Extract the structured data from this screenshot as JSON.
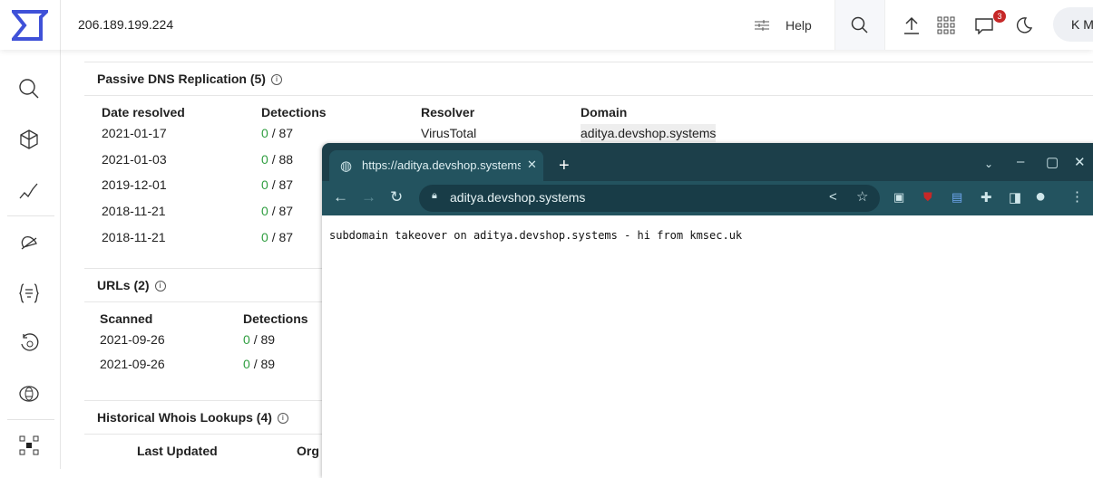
{
  "header": {
    "ip": "206.189.199.224",
    "help": "Help",
    "notification_count": "3",
    "user_initials": "K M"
  },
  "sidebar": {
    "items": [
      "search",
      "graph",
      "trend",
      "alerts",
      "rules",
      "retrohunt",
      "intelligence",
      "scan"
    ]
  },
  "passive_dns": {
    "title": "Passive DNS Replication",
    "count": "(5)",
    "columns": [
      "Date resolved",
      "Detections",
      "Resolver",
      "Domain"
    ],
    "rows": [
      [
        "2021-01-17",
        "0",
        "/ 87",
        "VirusTotal",
        "aditya.devshop.systems"
      ],
      [
        "2021-01-03",
        "0",
        "/ 88",
        "",
        ""
      ],
      [
        "2019-12-01",
        "0",
        "/ 87",
        "",
        ""
      ],
      [
        "2018-11-21",
        "0",
        "/ 87",
        "",
        ""
      ],
      [
        "2018-11-21",
        "0",
        "/ 87",
        "",
        ""
      ]
    ]
  },
  "urls": {
    "title": "URLs",
    "count": "(2)",
    "columns": [
      "Scanned",
      "Detections"
    ],
    "rows": [
      [
        "2021-09-26",
        "0",
        "/ 89"
      ],
      [
        "2021-09-26",
        "0",
        "/ 89"
      ]
    ]
  },
  "whois": {
    "title": "Historical Whois Lookups",
    "count": "(4)",
    "columns": [
      "Last Updated",
      "Org"
    ]
  },
  "browser": {
    "tab_title": "https://aditya.devshop.systems",
    "address": "aditya.devshop.systems",
    "page_text": "subdomain takeover on aditya.devshop.systems - hi from kmsec.uk"
  },
  "colors": {
    "brand": "#3f51d8",
    "positive": "#2e9d3f",
    "browser_frame": "#1c3f4a",
    "browser_toolbar": "#23535f"
  }
}
